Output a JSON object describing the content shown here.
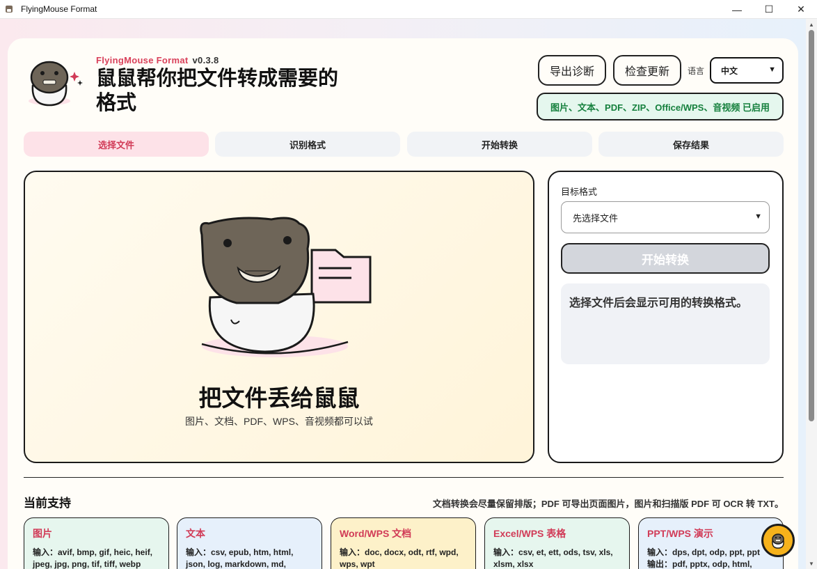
{
  "window": {
    "title": "FlyingMouse Format",
    "minimize": "—",
    "maximize": "☐",
    "close": "✕"
  },
  "header": {
    "brand": "FlyingMouse Format",
    "version": "v0.3.8",
    "headline": "鼠鼠帮你把文件转成需要的格式",
    "export_diag": "导出诊断",
    "check_update": "检查更新",
    "lang_label": "语言",
    "lang_value": "中文",
    "status": "图片、文本、PDF、ZIP、Office/WPS、音视频 已启用"
  },
  "steps": [
    {
      "label": "选择文件",
      "active": true
    },
    {
      "label": "识别格式",
      "active": false
    },
    {
      "label": "开始转换",
      "active": false
    },
    {
      "label": "保存结果",
      "active": false
    }
  ],
  "dropzone": {
    "title": "把文件丢给鼠鼠",
    "subtitle": "图片、文档、PDF、WPS、音视频都可以试"
  },
  "side": {
    "target_label": "目标格式",
    "target_value": "先选择文件",
    "convert_label": "开始转换",
    "hint": "选择文件后会显示可用的转换格式。"
  },
  "support": {
    "title": "当前支持",
    "note": "文档转换会尽量保留排版；PDF 可导出页面图片，图片和扫描版 PDF 可 OCR 转 TXT。",
    "cards": [
      {
        "name": "图片",
        "line1": "输入：avif, bmp, gif, heic, heif,",
        "line2": "jpeg, jpg, png, tif, tiff, webp",
        "bg": "#e6f6ee"
      },
      {
        "name": "文本",
        "line1": "输入：csv, epub, htm, html,",
        "line2": "json, log, markdown, md,",
        "bg": "#e6f0fb"
      },
      {
        "name": "Word/WPS 文档",
        "line1": "输入：doc, docx, odt, rtf, wpd,",
        "line2": "wps, wpt",
        "bg": "#fdf1c9"
      },
      {
        "name": "Excel/WPS 表格",
        "line1": "输入：csv, et, ett, ods, tsv, xls,",
        "line2": "xlsm, xlsx",
        "bg": "#e6f6ee"
      },
      {
        "name": "PPT/WPS 演示",
        "line1": "输入：dps, dpt, odp, ppt, ppt",
        "line2": "输出：pdf, pptx, odp, html,",
        "bg": "#e6f0fb"
      }
    ]
  },
  "colors": {
    "accent": "#d13b57",
    "status_green": "#15803d",
    "fab": "#f6b21b"
  }
}
